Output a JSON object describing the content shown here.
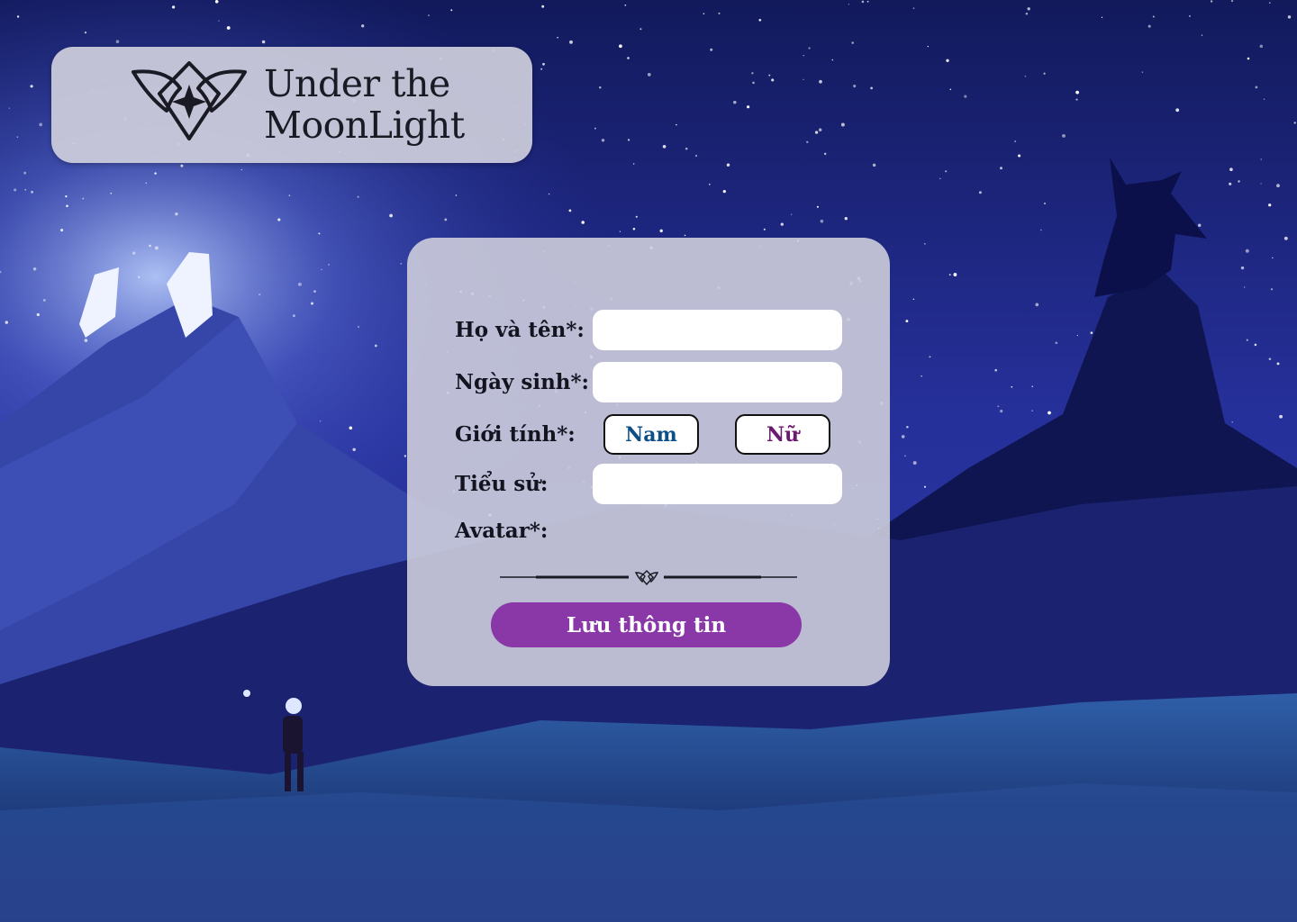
{
  "brand": {
    "line1": "Under the",
    "line2": "MoonLight",
    "emblem": "moon-wing-emblem-icon"
  },
  "form": {
    "fullname_label": "Họ và tên*:",
    "fullname_value": "",
    "birthdate_label": "Ngày sinh*:",
    "birthdate_value": "",
    "gender_label": "Giới tính*:",
    "gender_male": "Nam",
    "gender_female": "Nữ",
    "bio_label": "Tiểu sử:",
    "bio_value": "",
    "avatar_label": "Avatar*:",
    "divider_icon": "emblem-divider-icon",
    "submit_label": "Lưu thông tin"
  },
  "colors": {
    "accent": "#8a37a8",
    "male": "#0d4f86",
    "female": "#6b1a6e"
  }
}
